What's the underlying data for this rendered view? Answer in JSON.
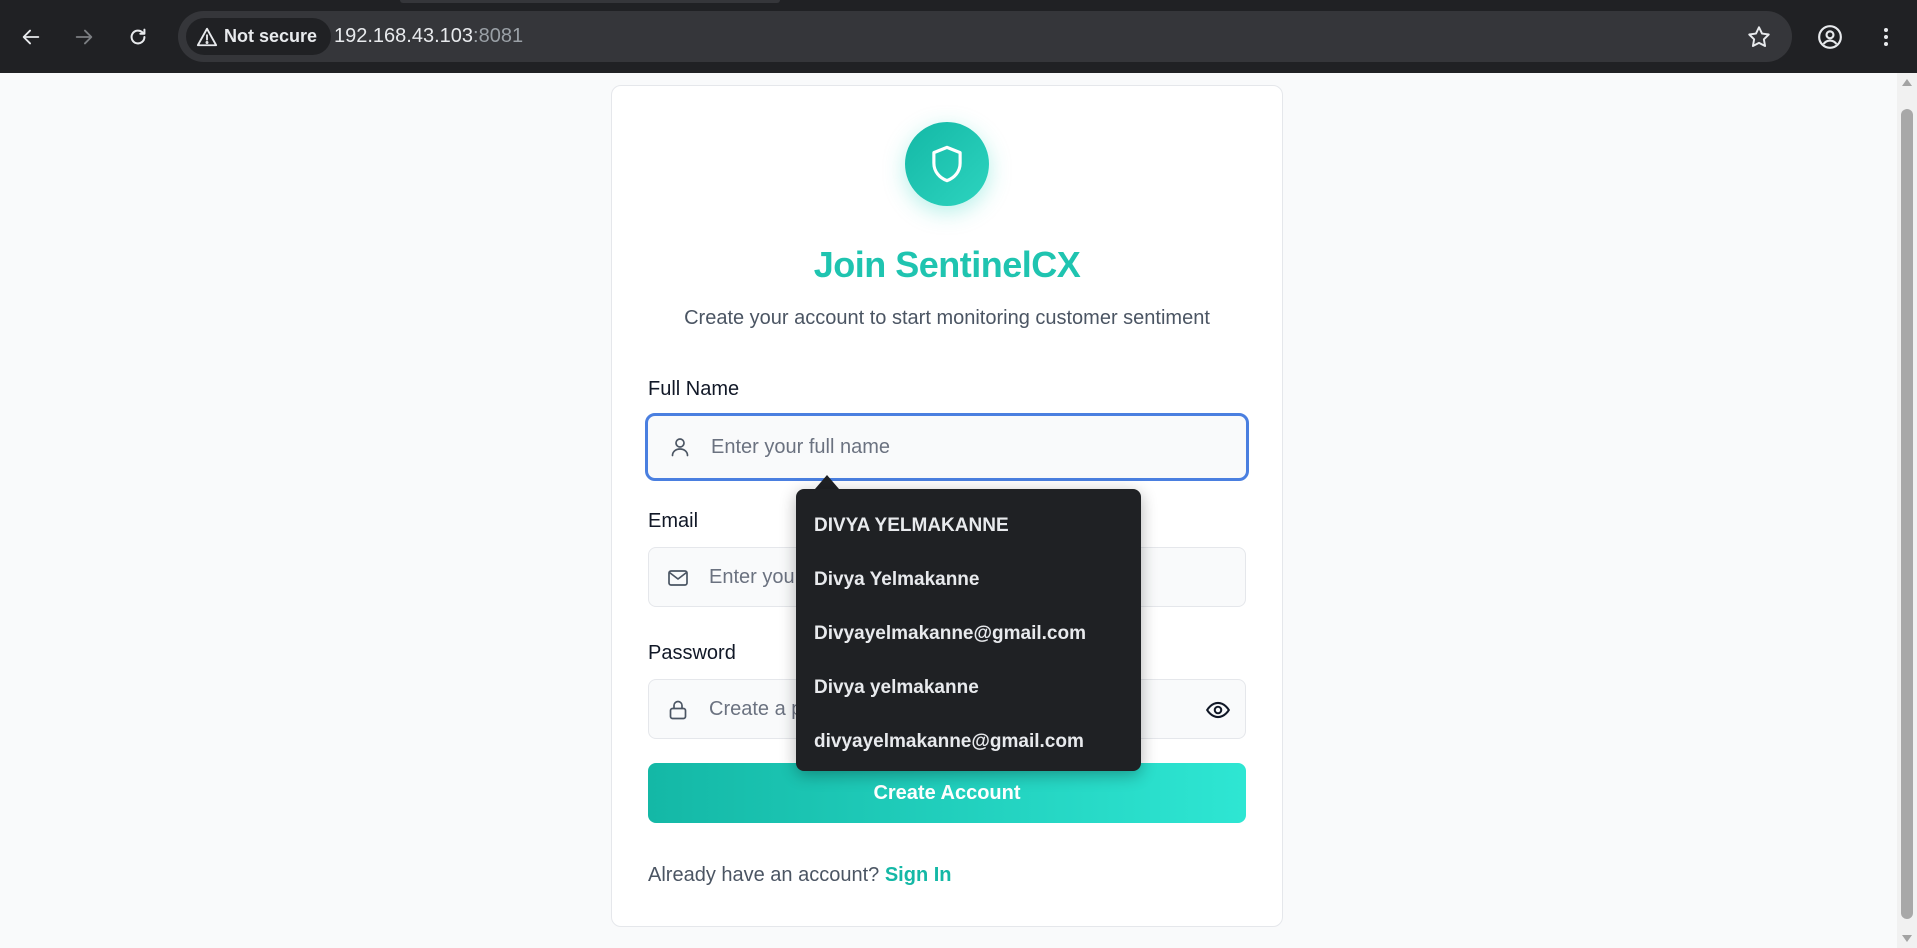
{
  "browser": {
    "security_label": "Not secure",
    "url_host": "192.168.43.103",
    "url_port": ":8081"
  },
  "signup": {
    "title": "Join SentinelCX",
    "subtitle": "Create your account to start monitoring customer sentiment",
    "full_name": {
      "label": "Full Name",
      "placeholder": "Enter your full name",
      "value": ""
    },
    "email": {
      "label": "Email",
      "placeholder": "Enter your email",
      "value": ""
    },
    "password": {
      "label": "Password",
      "placeholder": "Create a password",
      "value": ""
    },
    "submit_label": "Create Account",
    "footer_prompt": "Already have an account?",
    "footer_link": "Sign In"
  },
  "autofill": {
    "suggestions": [
      "DIVYA YELMAKANNE",
      "Divya Yelmakanne",
      "Divyayelmakanne@gmail.com",
      "Divya yelmakanne",
      "divyayelmakanne@gmail.com"
    ]
  },
  "colors": {
    "brand_teal": "#1fc4b0",
    "focus_ring": "#4a7fe0",
    "chrome_bg": "#202124"
  }
}
